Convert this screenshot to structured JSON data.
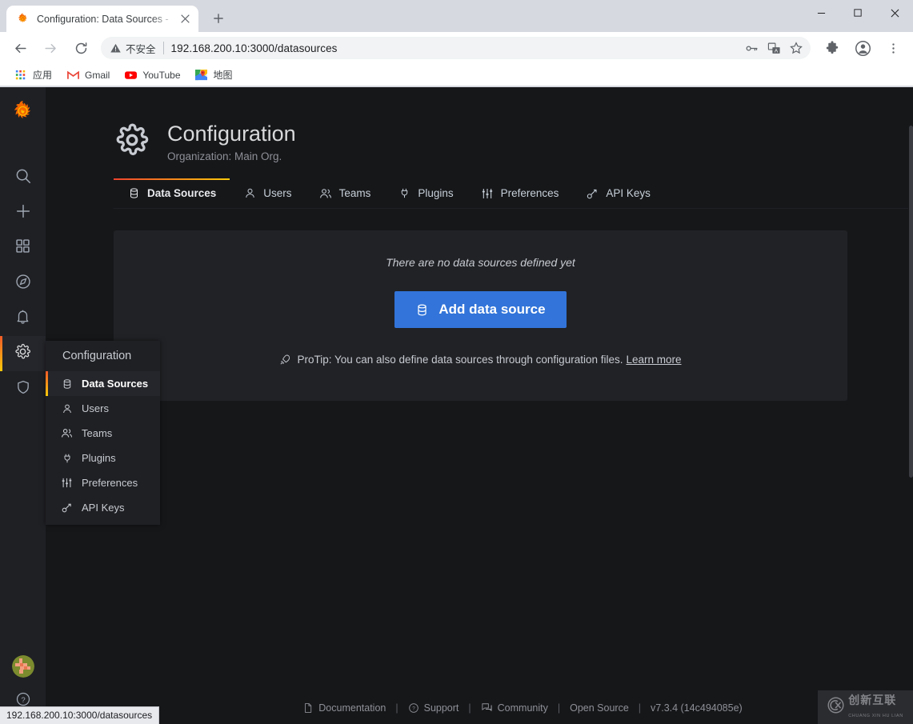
{
  "browser": {
    "tab": {
      "title": "Configuration: Data Sources - ",
      "favicon_name": "grafana-favicon",
      "close_label": "✕",
      "newtab_label": "+"
    },
    "window_controls": {
      "minimize": "—",
      "maximize": "□",
      "close": "✕"
    },
    "toolbar": {
      "back_label": "←",
      "forward_label": "→",
      "reload_label": "⟳",
      "security_text": "不安全",
      "url": "192.168.200.10:3000/datasources",
      "icons": [
        "key-icon",
        "translate-icon",
        "star-icon",
        "extensions-icon",
        "profile-icon",
        "menu-icon"
      ]
    },
    "bookmarks": [
      {
        "label": "应用",
        "icon": "apps-grid-icon"
      },
      {
        "label": "Gmail",
        "icon": "gmail-icon"
      },
      {
        "label": "YouTube",
        "icon": "youtube-icon"
      },
      {
        "label": "地图",
        "icon": "maps-icon"
      }
    ],
    "status_tooltip": "192.168.200.10:3000/datasources"
  },
  "sidemenu": {
    "brand_icon": "grafana-logo-icon",
    "items": [
      {
        "icon": "search-icon",
        "name": "search"
      },
      {
        "icon": "plus-icon",
        "name": "create"
      },
      {
        "icon": "dashboards-grid-icon",
        "name": "dashboards"
      },
      {
        "icon": "compass-icon",
        "name": "explore"
      },
      {
        "icon": "bell-icon",
        "name": "alerting"
      },
      {
        "icon": "gear-icon",
        "name": "configuration",
        "active": true
      },
      {
        "icon": "shield-icon",
        "name": "server-admin"
      }
    ],
    "avatar_icon": "user-avatar",
    "help_icon": "question-circle-icon",
    "accent_gradient_from": "#f05a28",
    "accent_gradient_to": "#fbca0a"
  },
  "flyout": {
    "header": "Configuration",
    "items": [
      {
        "label": "Data Sources",
        "icon": "database-icon",
        "active": true
      },
      {
        "label": "Users",
        "icon": "user-icon",
        "active": false
      },
      {
        "label": "Teams",
        "icon": "users-icon",
        "active": false
      },
      {
        "label": "Plugins",
        "icon": "plug-icon",
        "active": false
      },
      {
        "label": "Preferences",
        "icon": "sliders-icon",
        "active": false
      },
      {
        "label": "API Keys",
        "icon": "key-skeleton-icon",
        "active": false
      }
    ]
  },
  "page": {
    "header": {
      "icon": "gear-icon",
      "title": "Configuration",
      "subtitle": "Organization: Main Org."
    },
    "tabs": [
      {
        "label": "Data Sources",
        "icon": "database-icon",
        "active": true
      },
      {
        "label": "Users",
        "icon": "user-icon",
        "active": false
      },
      {
        "label": "Teams",
        "icon": "users-icon",
        "active": false
      },
      {
        "label": "Plugins",
        "icon": "plug-icon",
        "active": false
      },
      {
        "label": "Preferences",
        "icon": "sliders-icon",
        "active": false
      },
      {
        "label": "API Keys",
        "icon": "key-skeleton-icon",
        "active": false
      }
    ],
    "empty_state": {
      "message": "There are no data sources defined yet",
      "button_label": "Add data source",
      "button_icon": "database-icon",
      "button_color": "#3274d9",
      "protip_icon": "rocket-icon",
      "protip_text": "ProTip: You can also define data sources through configuration files.",
      "protip_link": "Learn more"
    }
  },
  "footer": {
    "items": [
      {
        "label": "Documentation",
        "icon": "document-icon",
        "link": true
      },
      {
        "label": "Support",
        "icon": "question-circle-icon",
        "link": true
      },
      {
        "label": "Community",
        "icon": "comments-icon",
        "link": true
      },
      {
        "label": "Open Source",
        "icon": "",
        "link": true
      },
      {
        "label": "v7.3.4 (14c494085e)",
        "icon": "",
        "link": false
      }
    ],
    "separator": "|"
  },
  "watermark": {
    "cn": "创新互联",
    "pinyin": "CHUANG XIN HU LIAN",
    "icon": "cx-logo-icon"
  }
}
